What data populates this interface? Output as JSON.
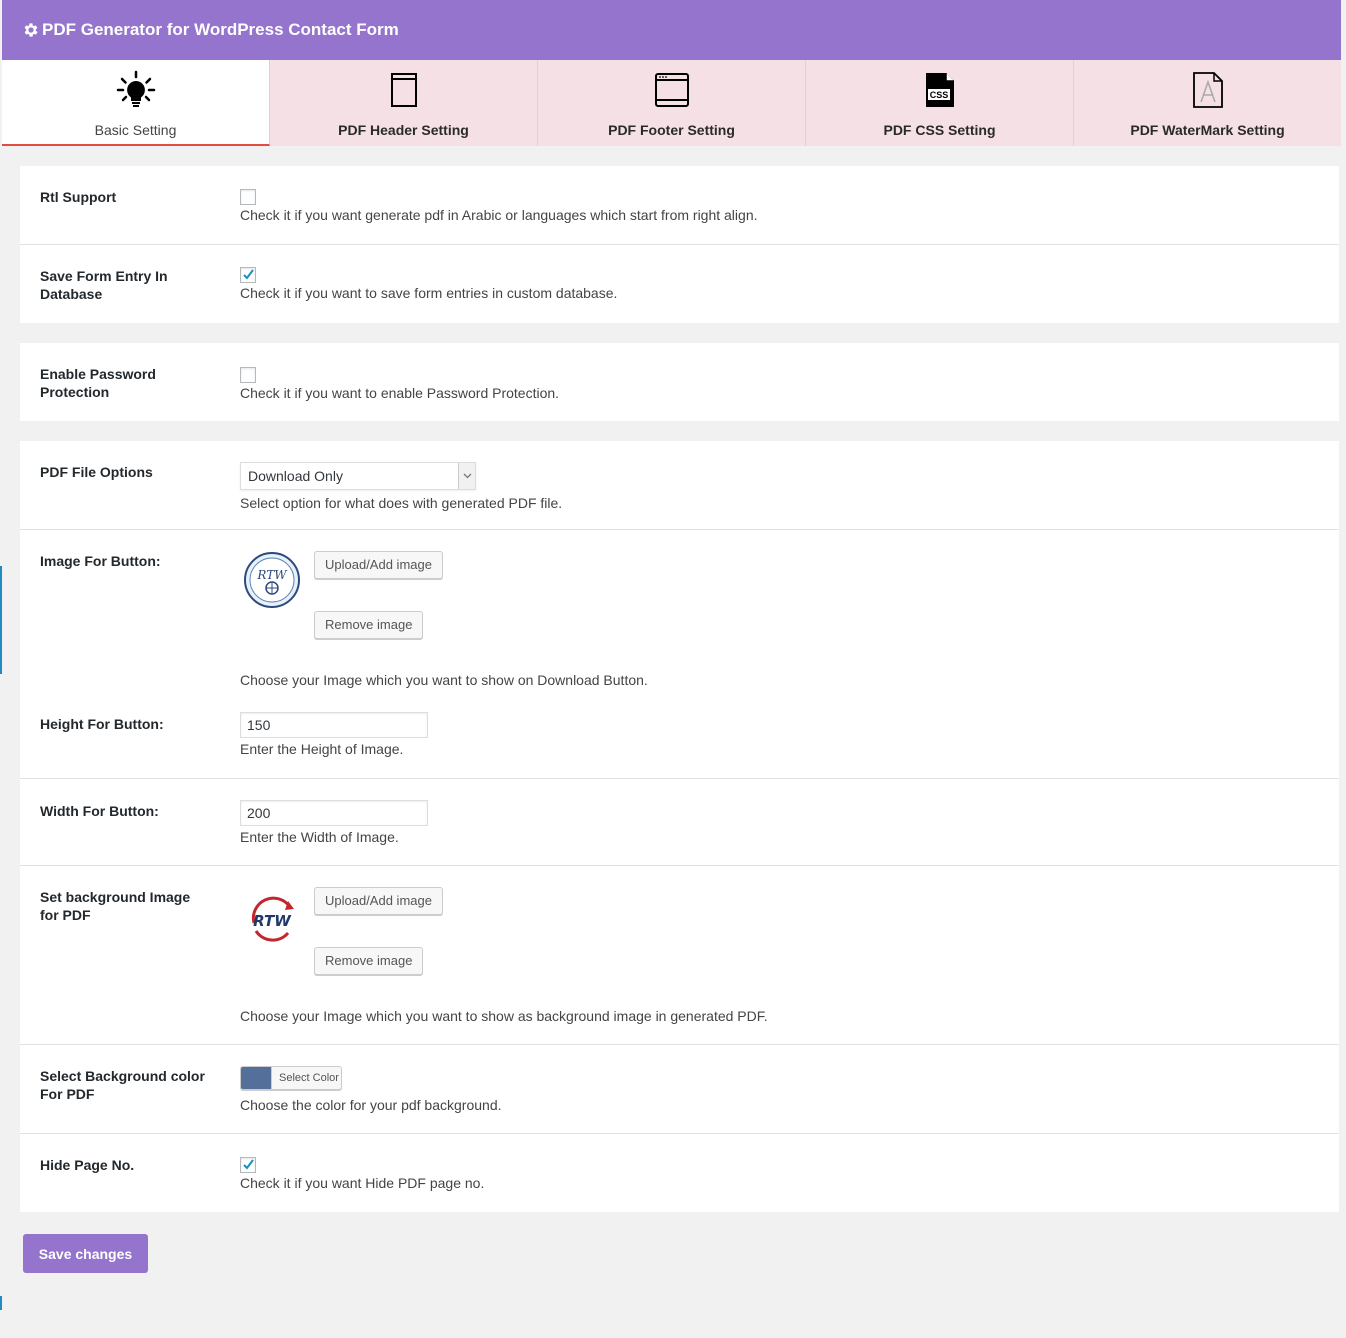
{
  "header": {
    "title": "PDF Generator for WordPress Contact Form"
  },
  "tabs": [
    {
      "label": "Basic Setting",
      "icon": "lightbulb-icon"
    },
    {
      "label": "PDF Header Setting",
      "icon": "document-icon"
    },
    {
      "label": "PDF Footer Setting",
      "icon": "browser-window-icon"
    },
    {
      "label": "PDF CSS Setting",
      "icon": "css-file-icon"
    },
    {
      "label": "PDF WaterMark Setting",
      "icon": "watermark-file-icon"
    }
  ],
  "fields": {
    "rtl": {
      "label": "Rtl Support",
      "checked": false,
      "desc": "Check it if you want generate pdf in Arabic or languages which start from right align."
    },
    "save_entry": {
      "label": "Save Form Entry In Database",
      "checked": true,
      "desc": "Check it if you want to save form entries in custom database."
    },
    "password": {
      "label": "Enable Password Protection",
      "checked": false,
      "desc": "Check it if you want to enable Password Protection."
    },
    "file_options": {
      "label": "PDF File Options",
      "value": "Download Only",
      "desc": "Select option for what does with generated PDF file."
    },
    "button_image": {
      "label": "Image For Button:",
      "upload": "Upload/Add image",
      "remove": "Remove image",
      "logo_text": "RTW",
      "desc": "Choose your Image which you want to show on Download Button."
    },
    "height": {
      "label": "Height For Button:",
      "value": "150",
      "desc": "Enter the Height of Image."
    },
    "width": {
      "label": "Width For Button:",
      "value": "200",
      "desc": "Enter the Width of Image."
    },
    "bg_image": {
      "label": "Set background Image for PDF",
      "upload": "Upload/Add image",
      "remove": "Remove image",
      "logo_text": "RTW",
      "desc": "Choose your Image which you want to show as background image in generated PDF."
    },
    "bg_color": {
      "label": "Select Background color For PDF",
      "button": "Select Color",
      "color": "#54709a",
      "desc": "Choose the color for your pdf background."
    },
    "hide_page": {
      "label": "Hide Page No.",
      "checked": true,
      "desc": "Check it if you want Hide PDF page no."
    }
  },
  "save_button": "Save changes",
  "colors": {
    "accent": "#9474cc",
    "tab_bg": "#f5e1e5",
    "active_border": "#e14d43"
  }
}
